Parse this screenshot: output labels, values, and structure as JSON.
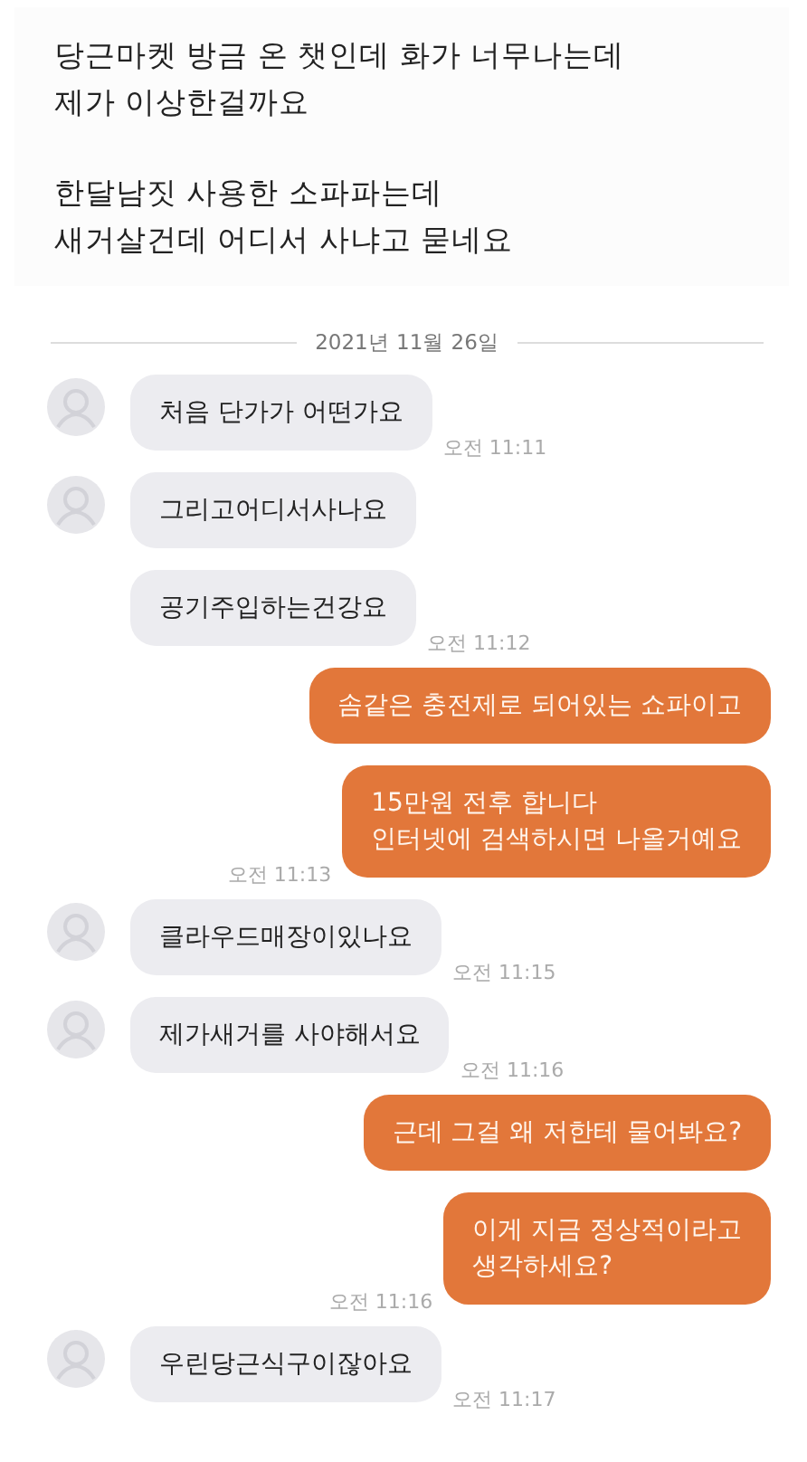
{
  "post": {
    "paragraphs": [
      "당근마켓 방금 온 챗인데 화가 너무나는데\n제가 이상한걸까요",
      "한달남짓 사용한 소파파는데\n새거살건데 어디서 사냐고 묻네요"
    ]
  },
  "chat": {
    "date": "2021년 11월 26일",
    "messages": [
      {
        "kind": "received",
        "avatar": true,
        "text": "처음 단가가 어떤가요",
        "time": "오전 11:11"
      },
      {
        "kind": "received",
        "avatar": true,
        "text": "그리고어디서사나요"
      },
      {
        "kind": "received",
        "avatar": false,
        "text": "공기주입하는건강요",
        "time": "오전 11:12"
      },
      {
        "kind": "sent",
        "text": "솜같은 충전제로 되어있는 쇼파이고"
      },
      {
        "kind": "sent",
        "text": "15만원 전후 합니다\n인터넷에 검색하시면 나올거예요",
        "time": "오전 11:13"
      },
      {
        "kind": "received",
        "avatar": true,
        "text": "클라우드매장이있나요",
        "time": "오전 11:15"
      },
      {
        "kind": "received",
        "avatar": true,
        "text": "제가새거를 사야해서요",
        "time": "오전 11:16"
      },
      {
        "kind": "sent",
        "text": "근데 그걸 왜 저한테 물어봐요?"
      },
      {
        "kind": "sent",
        "text": "이게 지금 정상적이라고\n생각하세요?",
        "time": "오전 11:16"
      },
      {
        "kind": "received",
        "avatar": true,
        "text": "우린당근식구이잖아요",
        "time": "오전 11:17"
      }
    ]
  }
}
